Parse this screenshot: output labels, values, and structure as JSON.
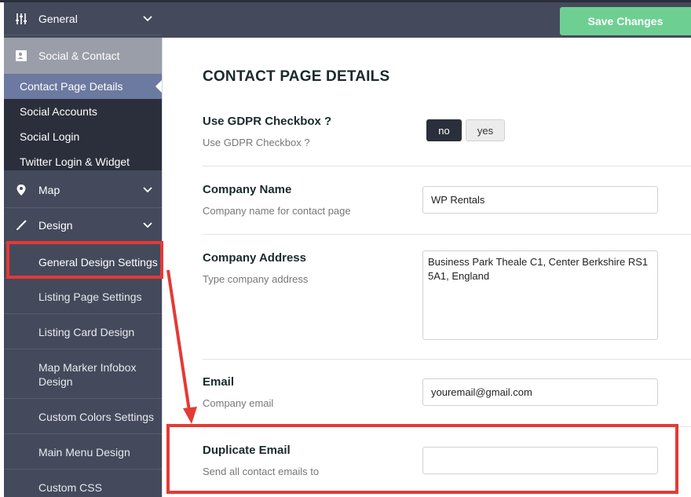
{
  "toolbar": {
    "save_label": "Save Changes"
  },
  "sidebar": {
    "general": "General",
    "social_contact": "Social & Contact",
    "sub": [
      "Contact Page Details",
      "Social Accounts",
      "Social Login",
      "Twitter Login & Widget"
    ],
    "map": "Map",
    "design": "Design",
    "design_sub": [
      "General Design Settings",
      "Listing Page Settings",
      "Listing Card Design",
      "Map Marker Infobox Design",
      "Custom Colors Settings",
      "Main Menu Design",
      "Custom CSS"
    ]
  },
  "main": {
    "title": "CONTACT PAGE DETAILS",
    "gdpr": {
      "label": "Use GDPR Checkbox ?",
      "desc": "Use GDPR Checkbox ?",
      "no": "no",
      "yes": "yes"
    },
    "company_name": {
      "label": "Company Name",
      "desc": "Company name for contact page",
      "value": "WP Rentals"
    },
    "company_address": {
      "label": "Company Address",
      "desc": "Type company address",
      "value": "Business Park Theale C1, Center Berkshire RS1 5A1, England"
    },
    "email": {
      "label": "Email",
      "desc": "Company email",
      "value": "youremail@gmail.com"
    },
    "duplicate_email": {
      "label": "Duplicate Email",
      "desc": "Send all contact emails to",
      "value": ""
    }
  },
  "colors": {
    "sidebar": "#444a5c",
    "active_sub": "#6c79a0",
    "save": "#6ecf93",
    "annotation": "#e53935"
  }
}
